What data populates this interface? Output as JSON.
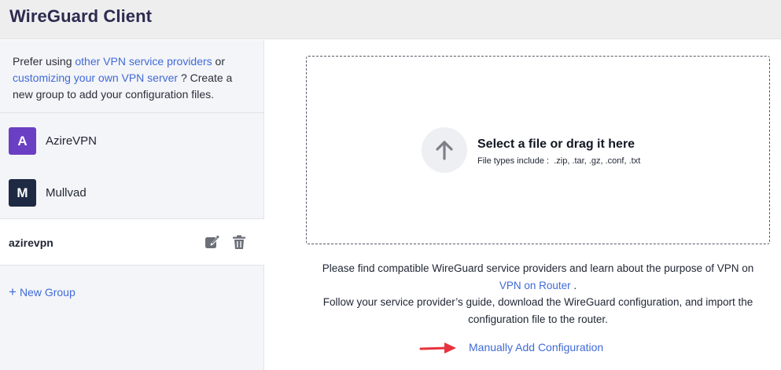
{
  "header": {
    "title": "WireGuard Client"
  },
  "sidebar": {
    "promo": {
      "prefix": "Prefer using ",
      "link1": "other VPN service providers",
      "middle": " or ",
      "link2": "customizing your own VPN server",
      "suffix": " ? Create a new group to add your configuration files."
    },
    "providers": [
      {
        "initial": "A",
        "name": "AzireVPN",
        "color": "#6b3fc4"
      },
      {
        "initial": "M",
        "name": "Mullvad",
        "color": "#1e2a44"
      }
    ],
    "group": {
      "name": "azirevpn",
      "edit_icon": "edit-icon",
      "delete_icon": "trash-icon"
    },
    "new_group_label": "New Group"
  },
  "upload": {
    "title": "Select a file or drag it here",
    "types": "File types include :  .zip, .tar, .gz, .conf, .txt",
    "icon": "upload-arrow-icon"
  },
  "info": {
    "line1": "Please find compatible WireGuard service providers and learn about the purpose of VPN on",
    "link": "VPN on Router",
    "line2_suffix": " .",
    "line3": "Follow your service provider’s guide, download the WireGuard configuration, and import the configuration file to the router."
  },
  "manual_link": "Manually Add Configuration",
  "colors": {
    "accent": "#3f6ad8",
    "arrow": "#e8323c"
  }
}
